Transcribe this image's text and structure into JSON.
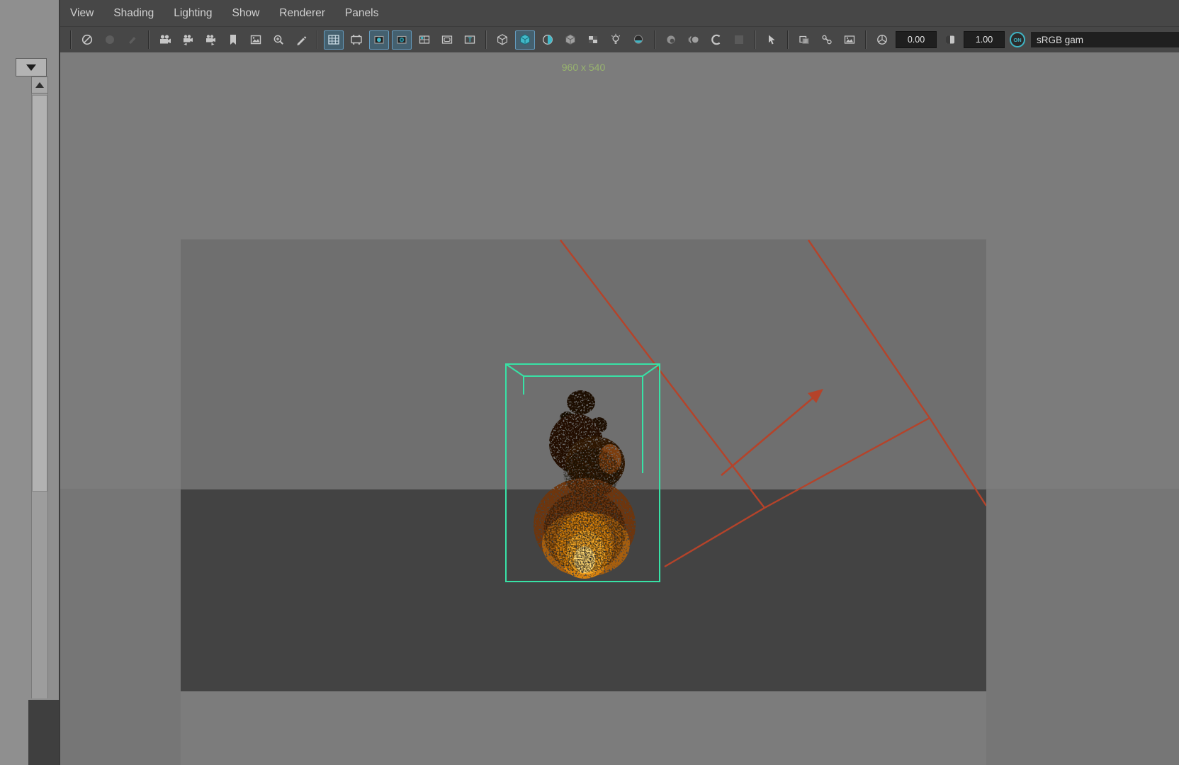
{
  "app": {
    "name": "3d-viewport-panel"
  },
  "left_panel": {
    "dropdown": "collapsed-option-menu",
    "scrollbar": "vertical-scrollbar"
  },
  "menu_bar": {
    "items": [
      {
        "label": "View"
      },
      {
        "label": "Shading"
      },
      {
        "label": "Lighting"
      },
      {
        "label": "Show"
      },
      {
        "label": "Renderer"
      },
      {
        "label": "Panels"
      }
    ]
  },
  "toolbar": {
    "exposure": {
      "value": "0.00"
    },
    "gamma": {
      "value": "1.00"
    },
    "on_toggle": {
      "label": "ON"
    },
    "view_transform": {
      "label": "sRGB gam"
    },
    "safe_title_glyph": "T",
    "icons": [
      "circle-slash",
      "dimmed-tool-a",
      "dimmed-tool-b",
      "select-camera",
      "camera-attributes-prev",
      "camera-attributes-next",
      "bookmark",
      "image-plane",
      "pan-zoom",
      "grease-pencil",
      "grid",
      "film-gate",
      "resolution-gate",
      "gate-mask",
      "field-chart",
      "safe-action",
      "safe-title",
      "wireframe",
      "smooth-shade",
      "textured",
      "use-default-material",
      "wireframe-on-shaded",
      "lighting",
      "shadows",
      "screen-space-ao",
      "motion-blur",
      "anti-aliasing",
      "disabled-slot",
      "isolate-select",
      "x-ray",
      "x-ray-joints",
      "texture-snapshot",
      "exposure",
      "contrast",
      "on-toggle",
      "view-transform"
    ],
    "active_toggles": [
      "grid",
      "resolution-gate",
      "gate-mask",
      "smooth-shade"
    ]
  },
  "viewport": {
    "resolution_gate_label": "960 x 540",
    "colors": {
      "viewport_bg": "#7c7c7c",
      "gate_upper": "#6f6f6f",
      "gate_ground": "#434343",
      "resolution_label": "#98b46e",
      "fluid_container_wire": "#38e2a6",
      "light_wire": "#b5432a",
      "fire_core": "#ffd975"
    },
    "scene_objects": [
      "fluid-container-wireframe",
      "fire-simulation",
      "light-frustum-wireframe",
      "direction-arrow"
    ]
  }
}
